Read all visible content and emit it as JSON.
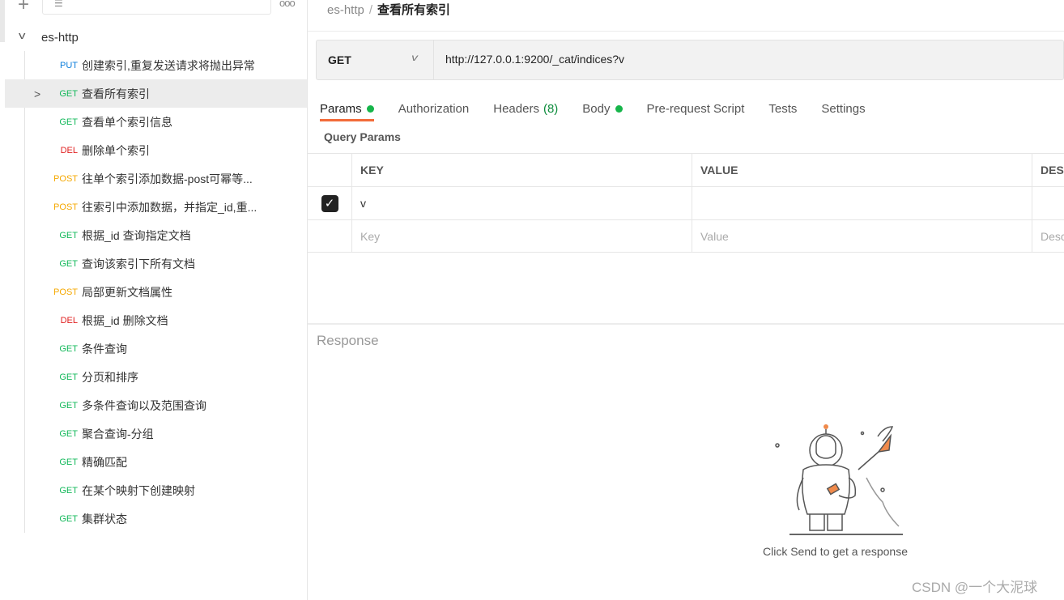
{
  "sidebar": {
    "more_icon": "more-horizontal-icon",
    "collection": "es-http",
    "items": [
      {
        "method": "PUT",
        "color": "#0b7ddb",
        "title": "创建索引,重复发送请求将抛出异常"
      },
      {
        "method": "GET",
        "color": "#12b85a",
        "title": "查看所有索引",
        "selected": true
      },
      {
        "method": "GET",
        "color": "#12b85a",
        "title": "查看单个索引信息"
      },
      {
        "method": "DEL",
        "color": "#e02020",
        "title": "删除单个索引"
      },
      {
        "method": "POST",
        "color": "#f5a800",
        "title": "往单个索引添加数据-post可幂等..."
      },
      {
        "method": "POST",
        "color": "#f5a800",
        "title": "往索引中添加数据，并指定_id,重..."
      },
      {
        "method": "GET",
        "color": "#12b85a",
        "title": "根据_id 查询指定文档"
      },
      {
        "method": "GET",
        "color": "#12b85a",
        "title": "查询该索引下所有文档"
      },
      {
        "method": "POST",
        "color": "#f5a800",
        "title": "局部更新文档属性"
      },
      {
        "method": "DEL",
        "color": "#e02020",
        "title": "根据_id 删除文档"
      },
      {
        "method": "GET",
        "color": "#12b85a",
        "title": "条件查询"
      },
      {
        "method": "GET",
        "color": "#12b85a",
        "title": "分页和排序"
      },
      {
        "method": "GET",
        "color": "#12b85a",
        "title": "多条件查询以及范围查询"
      },
      {
        "method": "GET",
        "color": "#12b85a",
        "title": "聚合查询-分组"
      },
      {
        "method": "GET",
        "color": "#12b85a",
        "title": "精确匹配"
      },
      {
        "method": "GET",
        "color": "#12b85a",
        "title": "在某个映射下创建映射"
      },
      {
        "method": "GET",
        "color": "#12b85a",
        "title": "集群状态"
      }
    ]
  },
  "breadcrumb": {
    "collection": "es-http",
    "sep": "/",
    "request": "查看所有索引"
  },
  "request": {
    "method": "GET",
    "url": "http://127.0.0.1:9200/_cat/indices?v"
  },
  "tabs": [
    {
      "label": "Params",
      "dot": true,
      "active": true
    },
    {
      "label": "Authorization"
    },
    {
      "label": "Headers",
      "count": "(8)"
    },
    {
      "label": "Body",
      "dot": true
    },
    {
      "label": "Pre-request Script"
    },
    {
      "label": "Tests"
    },
    {
      "label": "Settings"
    }
  ],
  "query_params": {
    "title": "Query Params",
    "headers": [
      "KEY",
      "VALUE",
      "DESCRIPTION"
    ],
    "rows": [
      {
        "checked": true,
        "key": "v",
        "value": "",
        "description": ""
      }
    ],
    "placeholders": {
      "key": "Key",
      "value": "Value",
      "description": "Description"
    }
  },
  "response": {
    "title": "Response",
    "hint": "Click Send to get a response"
  },
  "watermark": "CSDN @一个大泥球",
  "colors": {
    "accent": "#f26b3a",
    "dot": "#16b54a"
  }
}
